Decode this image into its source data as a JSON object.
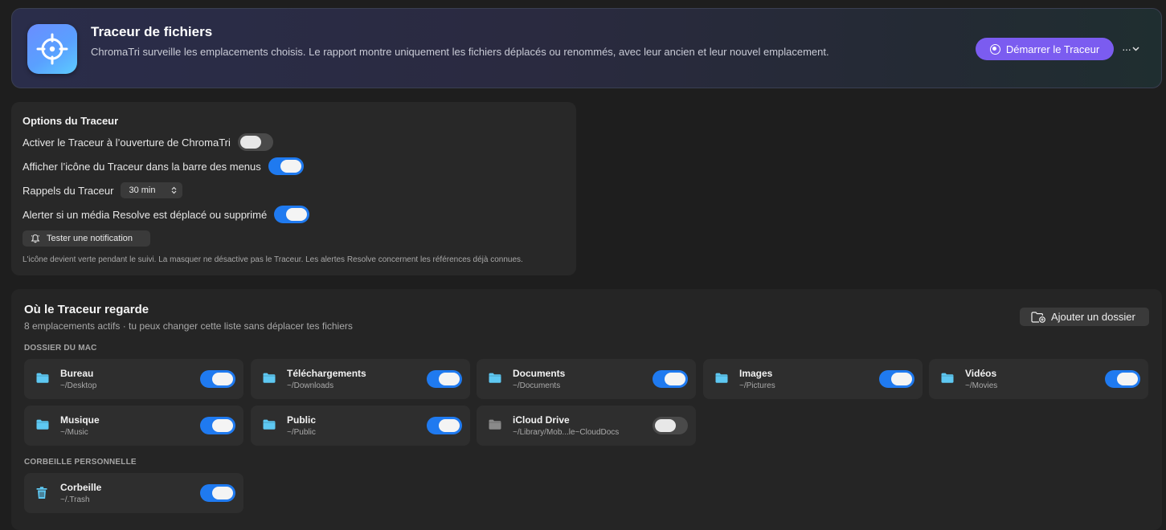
{
  "header": {
    "title": "Traceur de fichiers",
    "subtitle": "ChromaTri surveille les emplacements choisis. Le rapport montre uniquement les fichiers déplacés ou renommés, avec leur ancien et leur nouvel emplacement.",
    "start_label": "Démarrer le Traceur",
    "more_label": "···",
    "app_icon": "crosshair-target-icon",
    "accent_color": "#7b5cf0"
  },
  "options": {
    "title": "Options du Traceur",
    "open_at_launch": {
      "label": "Activer le Traceur à l’ouverture de ChromaTri",
      "enabled": false
    },
    "menubar_icon": {
      "label": "Afficher l’icône du Traceur dans la barre des menus",
      "enabled": true
    },
    "reminders": {
      "label": "Rappels du Traceur",
      "value": "30 min"
    },
    "resolve_alert": {
      "label": "Alerter si un média Resolve est déplacé ou supprimé",
      "enabled": true
    },
    "test_button": "Tester une notification",
    "note": "L'icône devient verte pendant le suivi. La masquer ne désactive pas le Traceur. Les alertes Resolve concernent les références déjà connues."
  },
  "watch": {
    "title": "Où le Traceur regarde",
    "subtitle": "8 emplacements actifs · tu peux changer cette liste sans déplacer tes fichiers",
    "add_button": "Ajouter un dossier",
    "mac_section": "DOSSIER DU MAC",
    "trash_section": "CORBEILLE PERSONNELLE",
    "mac_folders": [
      {
        "name": "Bureau",
        "path": "~/Desktop",
        "enabled": true,
        "icon": "folder-icon"
      },
      {
        "name": "Téléchargements",
        "path": "~/Downloads",
        "enabled": true,
        "icon": "folder-icon"
      },
      {
        "name": "Documents",
        "path": "~/Documents",
        "enabled": true,
        "icon": "folder-icon"
      },
      {
        "name": "Images",
        "path": "~/Pictures",
        "enabled": true,
        "icon": "folder-icon"
      },
      {
        "name": "Vidéos",
        "path": "~/Movies",
        "enabled": true,
        "icon": "folder-icon"
      },
      {
        "name": "Musique",
        "path": "~/Music",
        "enabled": true,
        "icon": "folder-icon"
      },
      {
        "name": "Public",
        "path": "~/Public",
        "enabled": true,
        "icon": "folder-icon"
      },
      {
        "name": "iCloud Drive",
        "path": "~/Library/Mob...le~CloudDocs",
        "enabled": false,
        "icon": "folder-icon"
      }
    ],
    "trash": {
      "name": "Corbeille",
      "path": "~/.Trash",
      "enabled": true,
      "icon": "trash-icon"
    }
  },
  "colors": {
    "toggle_on": "#1f7af0",
    "folder_icon": "#5ec8f2",
    "folder_icon_disabled": "#8a8a8a"
  }
}
